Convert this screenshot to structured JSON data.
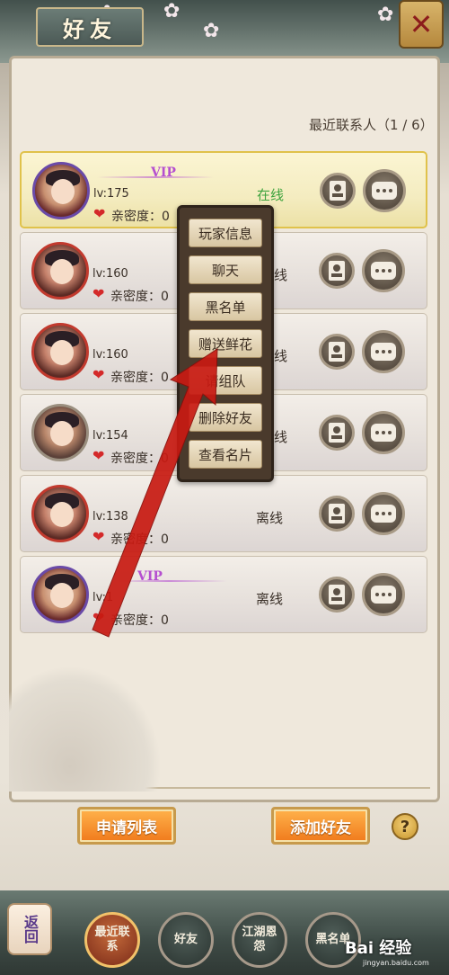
{
  "header": {
    "title": "好友",
    "close_icon": "close-icon"
  },
  "panel": {
    "recent_label": "最近联系人（1 / 6）"
  },
  "contacts": [
    {
      "vip": "VIP",
      "level": "lv:175",
      "intimacy": "亲密度：0",
      "status": "在线",
      "avatar": "purple"
    },
    {
      "vip": "",
      "level": "lv:160",
      "intimacy": "亲密度：0",
      "status": "线",
      "avatar": "red"
    },
    {
      "vip": "",
      "level": "lv:160",
      "intimacy": "亲密度：0",
      "status": "线",
      "avatar": "red"
    },
    {
      "vip": "",
      "level": "lv:154",
      "intimacy": "亲密度：0",
      "status": "线",
      "avatar": "gray"
    },
    {
      "vip": "",
      "level": "lv:138",
      "intimacy": "亲密度：0",
      "status": "离线",
      "avatar": "red"
    },
    {
      "vip": "VIP",
      "level": "lv:1",
      "intimacy": "亲密度：0",
      "status": "离线",
      "avatar": "purple"
    }
  ],
  "popup": {
    "items": [
      "玩家信息",
      "聊天",
      "黑名单",
      "赠送鲜花",
      "请组队",
      "删除好友",
      "查看名片"
    ]
  },
  "actions": {
    "request_list": "申请列表",
    "add_friend": "添加好友",
    "help": "?"
  },
  "bottom_nav": {
    "back": "返回",
    "tabs": [
      "最近联系",
      "好友",
      "江湖恩怨",
      "黑名单"
    ]
  },
  "watermark": {
    "text": "Bai 经验",
    "sub": "jingyan.baidu.com"
  },
  "colors": {
    "online": "#3ea33e",
    "accent_orange": "#f07a1c",
    "arrow_red": "#c81a12",
    "vip_purple": "#b54fd0"
  }
}
